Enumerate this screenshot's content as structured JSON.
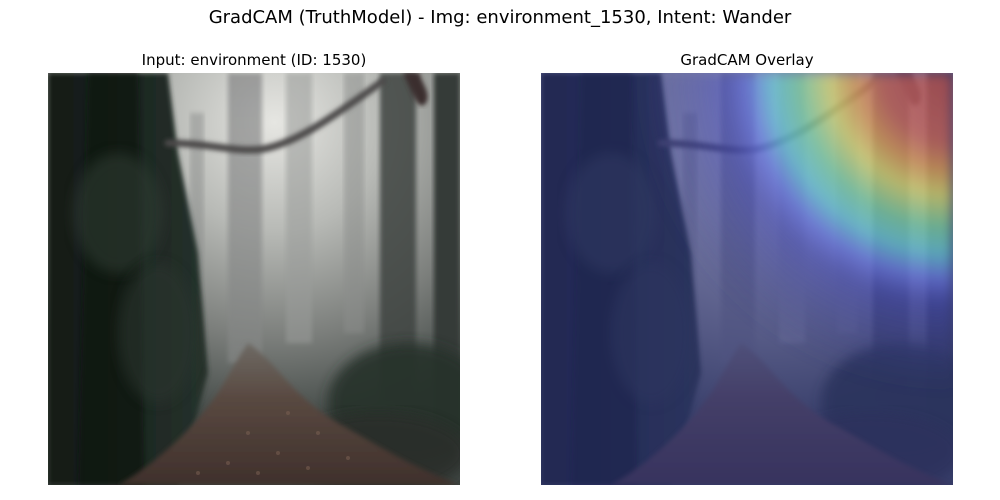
{
  "figure": {
    "title": "GradCAM (TruthModel) - Img: environment_1530, Intent: Wander"
  },
  "panels": [
    {
      "title": "Input: environment (ID: 1530)",
      "content": "forest-path-photo"
    },
    {
      "title": "GradCAM Overlay",
      "content": "forest-path-photo-with-jet-heatmap",
      "heatmap_colormap": "jet",
      "heatmap_hotspot": "top-right"
    }
  ],
  "colors": {
    "fog": "#c9cac6",
    "trunk": "#4e4f52",
    "foliage": "#1f2a25",
    "path": "#4b3a33",
    "overlay_tint": "#3b3f86",
    "heat_red": "#b34a4a",
    "heat_yellow": "#e6e36a",
    "heat_cyan": "#6ad0d8",
    "heat_blue": "#5b5fd6"
  }
}
